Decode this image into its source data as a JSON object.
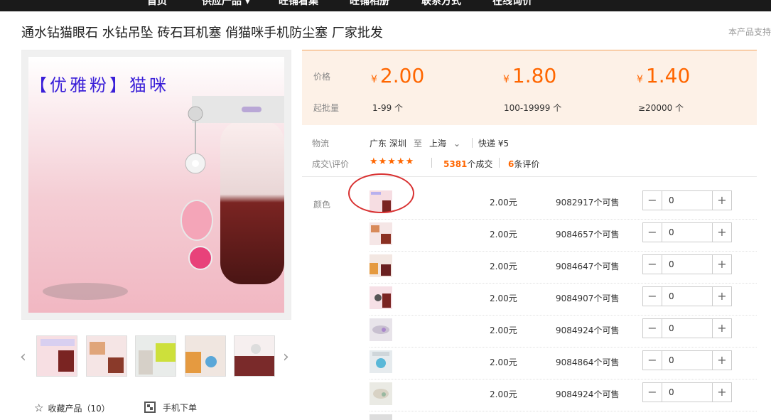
{
  "nav": {
    "items": [
      "首页",
      "供应产品 ▾",
      "旺铺看集",
      "旺铺相册",
      "联系方式",
      "在线询价"
    ]
  },
  "product": {
    "title": "通水钻猫眼石 水钻吊坠 砖石耳机塞 俏猫咪手机防尘塞 厂家批发",
    "support_text": "本产品支持",
    "image_caption": "【优雅粉】猫咪"
  },
  "pricing": {
    "price_label": "价格",
    "moq_label": "起批量",
    "currency_symbol": "¥",
    "tiers": [
      {
        "price": "2.00",
        "range": "1-99 个"
      },
      {
        "price": "1.80",
        "range": "100-19999 个"
      },
      {
        "price": "1.40",
        "range": "≥20000 个"
      }
    ]
  },
  "logistics": {
    "label": "物流",
    "from": "广东 深圳",
    "to_word": "至",
    "destination": "上海",
    "method": "快递 ¥5"
  },
  "deals": {
    "label": "成交\\评价",
    "stars": "★★★★★",
    "deal_count": "5381",
    "deal_suffix": "个成交",
    "review_count": "6",
    "review_suffix": "条评价"
  },
  "variants": {
    "label": "颜色",
    "rows": [
      {
        "price": "2.00元",
        "stock": "9082917个可售",
        "qty": "0"
      },
      {
        "price": "2.00元",
        "stock": "9084657个可售",
        "qty": "0"
      },
      {
        "price": "2.00元",
        "stock": "9084647个可售",
        "qty": "0"
      },
      {
        "price": "2.00元",
        "stock": "9084907个可售",
        "qty": "0"
      },
      {
        "price": "2.00元",
        "stock": "9084924个可售",
        "qty": "0"
      },
      {
        "price": "2.00元",
        "stock": "9084864个可售",
        "qty": "0"
      },
      {
        "price": "2.00元",
        "stock": "9084924个可售",
        "qty": "0"
      }
    ]
  },
  "actions": {
    "favorite": "收藏产品（10）",
    "mobile_order": "手机下单"
  },
  "colors": {
    "accent": "#ff6600",
    "highlight_circle": "#d83030",
    "price_bg": "#fdf1e7"
  }
}
